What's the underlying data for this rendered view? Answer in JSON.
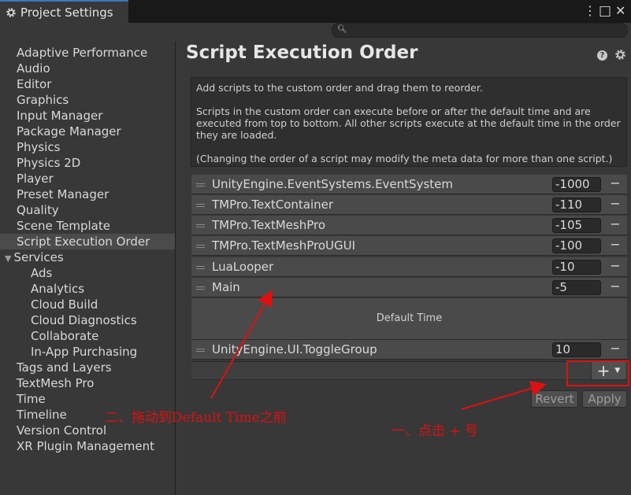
{
  "window": {
    "tab_title": "Project Settings",
    "menu_glyph": "⋮",
    "maximize_glyph": "□",
    "close_glyph": "✕"
  },
  "search": {
    "placeholder": "",
    "value": ""
  },
  "sidebar": {
    "items": [
      {
        "label": "Adaptive Performance",
        "indent": 0
      },
      {
        "label": "Audio",
        "indent": 0
      },
      {
        "label": "Editor",
        "indent": 0
      },
      {
        "label": "Graphics",
        "indent": 0
      },
      {
        "label": "Input Manager",
        "indent": 0
      },
      {
        "label": "Package Manager",
        "indent": 0
      },
      {
        "label": "Physics",
        "indent": 0
      },
      {
        "label": "Physics 2D",
        "indent": 0
      },
      {
        "label": "Player",
        "indent": 0
      },
      {
        "label": "Preset Manager",
        "indent": 0
      },
      {
        "label": "Quality",
        "indent": 0
      },
      {
        "label": "Scene Template",
        "indent": 0
      },
      {
        "label": "Script Execution Order",
        "indent": 0,
        "selected": true
      },
      {
        "label": "Services",
        "indent": 0,
        "expanded": true
      },
      {
        "label": "Ads",
        "indent": 1
      },
      {
        "label": "Analytics",
        "indent": 1
      },
      {
        "label": "Cloud Build",
        "indent": 1
      },
      {
        "label": "Cloud Diagnostics",
        "indent": 1
      },
      {
        "label": "Collaborate",
        "indent": 1
      },
      {
        "label": "In-App Purchasing",
        "indent": 1
      },
      {
        "label": "Tags and Layers",
        "indent": 0
      },
      {
        "label": "TextMesh Pro",
        "indent": 0
      },
      {
        "label": "Time",
        "indent": 0
      },
      {
        "label": "Timeline",
        "indent": 0
      },
      {
        "label": "Version Control",
        "indent": 0
      },
      {
        "label": "XR Plugin Management",
        "indent": 0
      }
    ]
  },
  "main": {
    "title": "Script Execution Order",
    "help_glyph": "?",
    "description": {
      "line1": "Add scripts to the custom order and drag them to reorder.",
      "line2": "Scripts in the custom order can execute before or after the default time and are",
      "line3": "executed from top to bottom. All other scripts execute at the default time in the order",
      "line4": "they are loaded.",
      "line5": "(Changing the order of a script may modify the meta data for more than one script.)"
    },
    "scripts_before": [
      {
        "name": "UnityEngine.EventSystems.EventSystem",
        "order": "-1000"
      },
      {
        "name": "TMPro.TextContainer",
        "order": "-110"
      },
      {
        "name": "TMPro.TextMeshPro",
        "order": "-105"
      },
      {
        "name": "TMPro.TextMeshProUGUI",
        "order": "-100"
      },
      {
        "name": "LuaLooper",
        "order": "-10"
      },
      {
        "name": "Main",
        "order": "-5"
      }
    ],
    "default_time_label": "Default Time",
    "scripts_after": [
      {
        "name": "UnityEngine.UI.ToggleGroup",
        "order": "10"
      }
    ],
    "remove_glyph": "−",
    "add_glyph": "+",
    "revert_label": "Revert",
    "apply_label": "Apply"
  },
  "annotations": {
    "step1": "一、点击 + 号",
    "step2": "二、拖动到Default Time之前",
    "color": "#e01010"
  }
}
